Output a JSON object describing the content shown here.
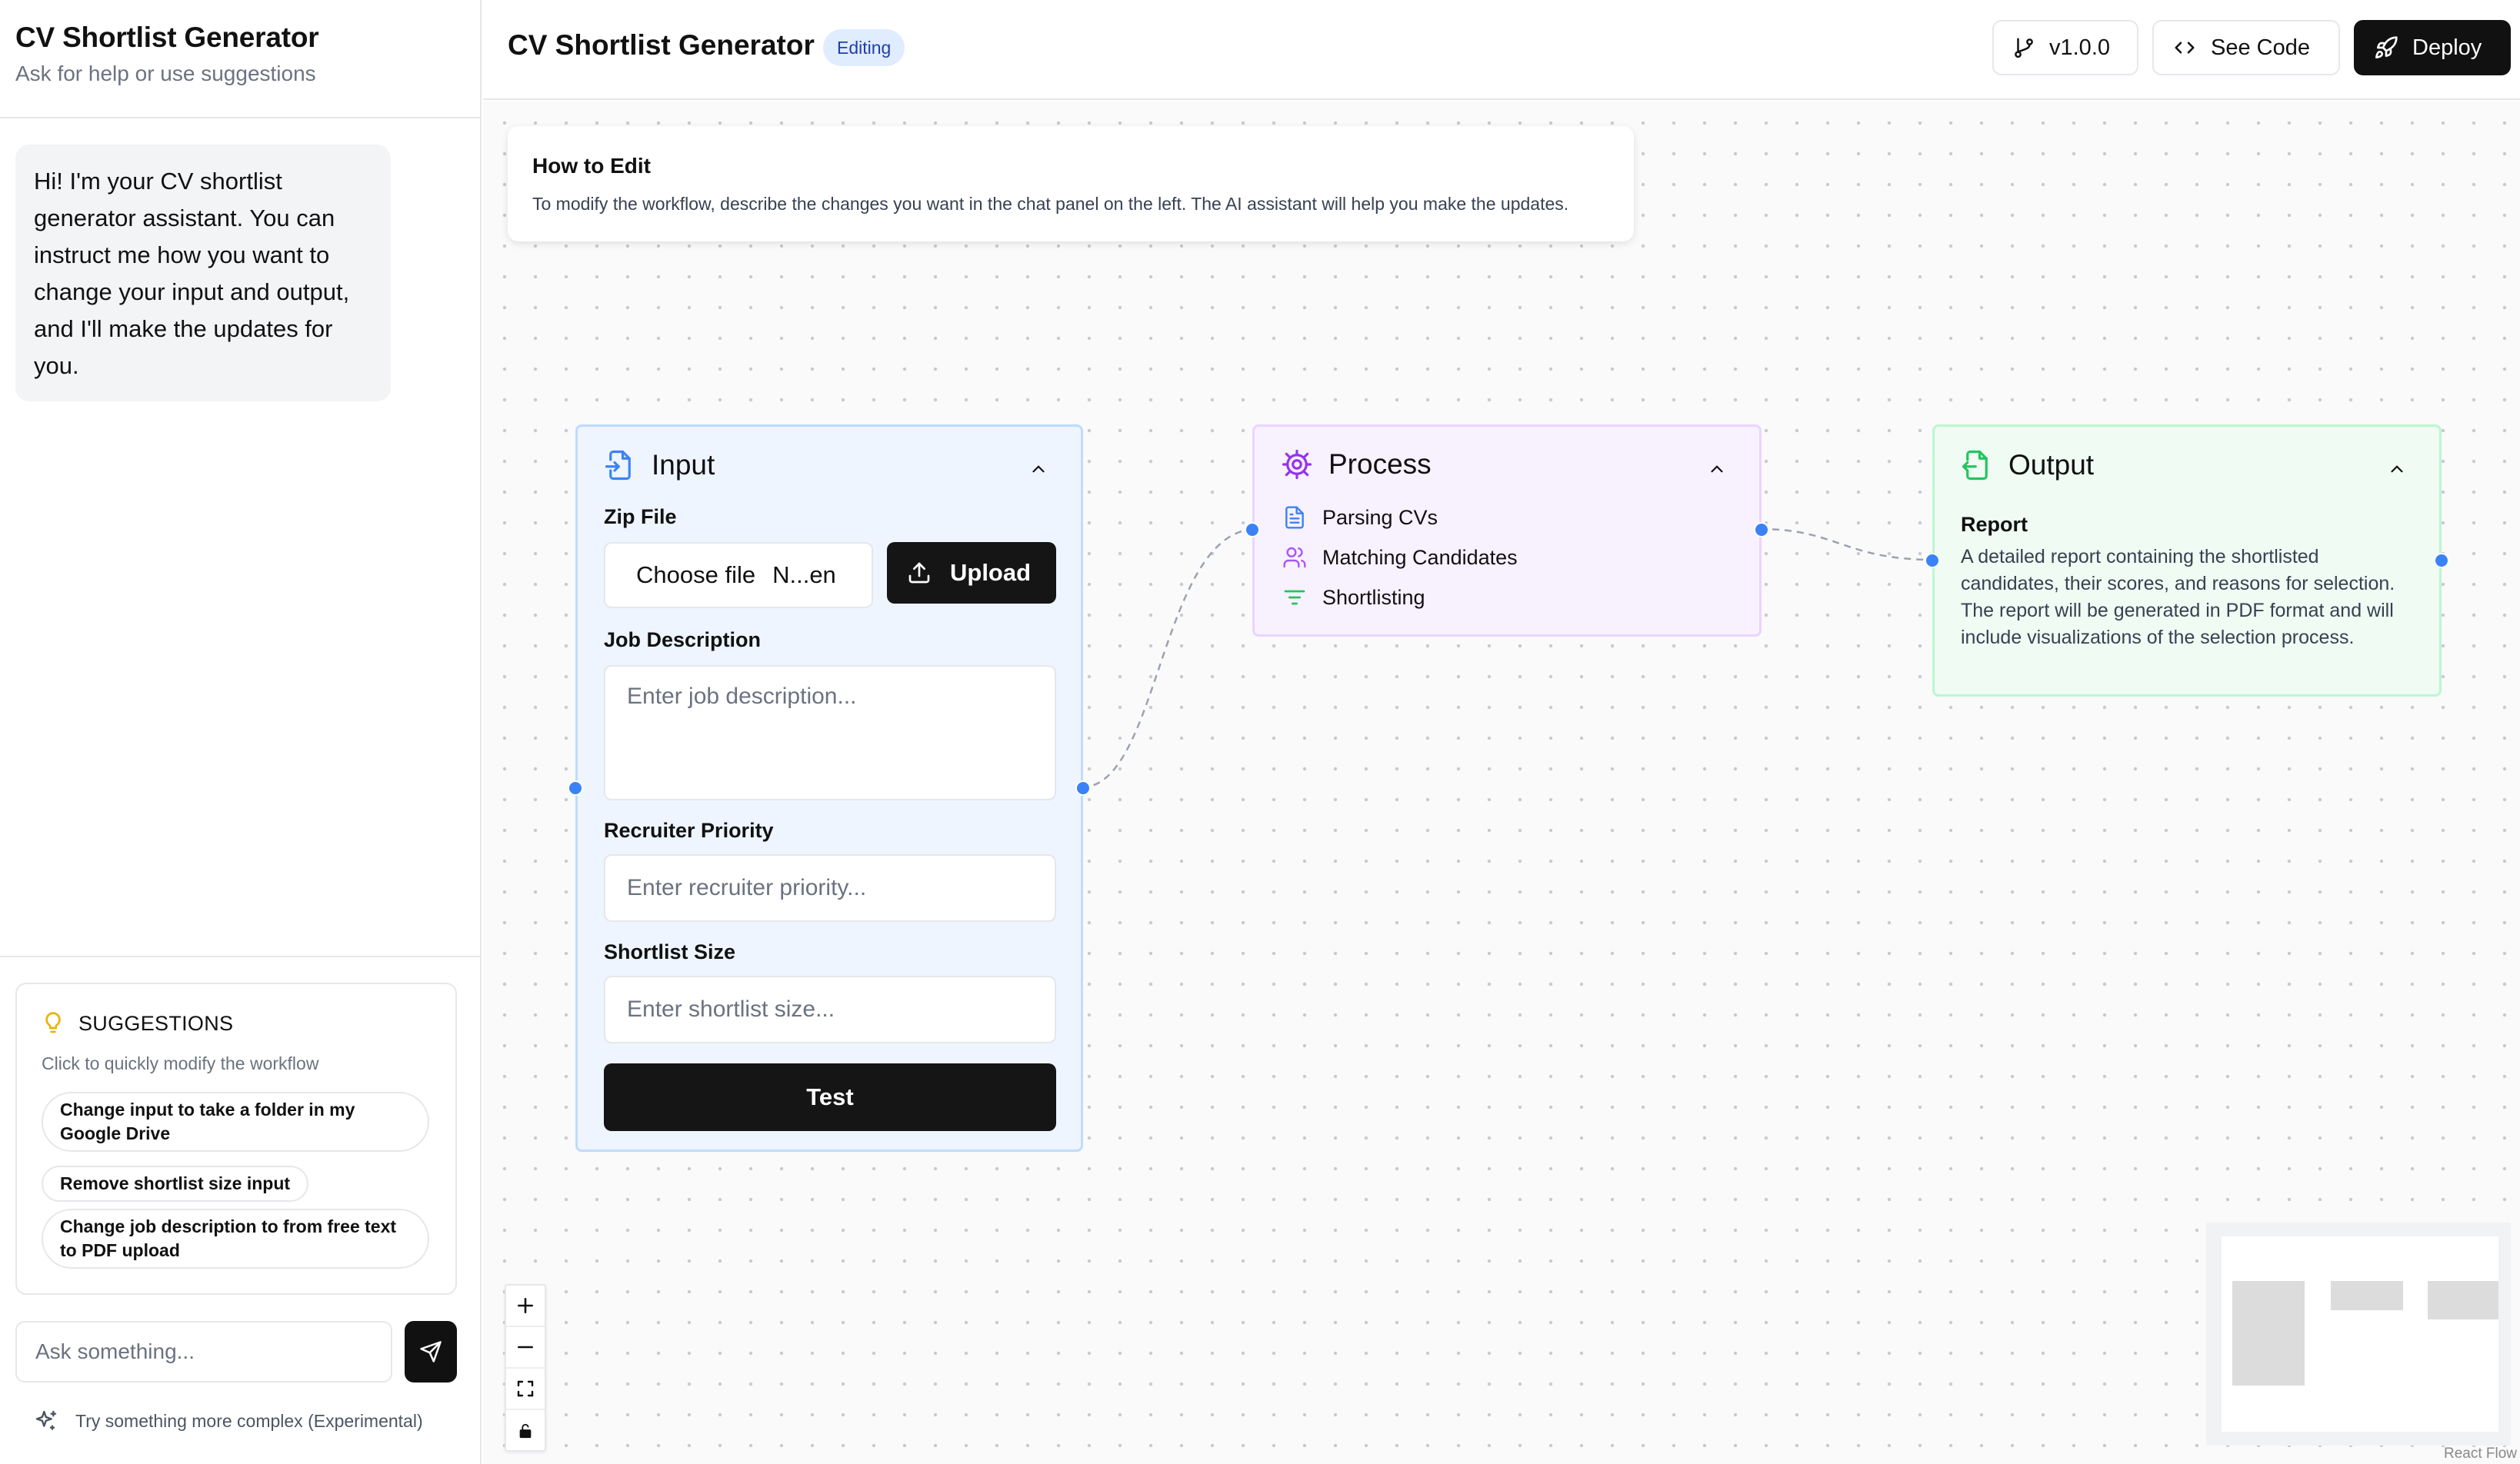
{
  "sidebar": {
    "title": "CV Shortlist Generator",
    "subtitle": "Ask for help or use suggestions",
    "assistant_message": "Hi! I'm your CV shortlist generator assistant. You can instruct me how you want to change your input and output, and I'll make the updates for you.",
    "suggestions": {
      "heading": "SUGGESTIONS",
      "subheading": "Click to quickly modify the workflow",
      "items": [
        "Change input to take a folder in my Google Drive",
        "Remove shortlist size input",
        "Change job description to from free text to PDF upload"
      ]
    },
    "ask_placeholder": "Ask something...",
    "complex_link": "Try something more complex (Experimental)"
  },
  "header": {
    "title": "CV Shortlist Generator",
    "badge": "Editing",
    "version_label": "v1.0.0",
    "see_code_label": "See Code",
    "deploy_label": "Deploy"
  },
  "howto": {
    "title": "How to Edit",
    "text": "To modify the workflow, describe the changes you want in the chat panel on the left. The AI assistant will help you make the updates."
  },
  "nodes": {
    "input": {
      "title": "Input",
      "zip_label": "Zip File",
      "choose_file": "Choose file",
      "file_name": "N...en",
      "upload_label": "Upload",
      "job_desc_label": "Job Description",
      "job_desc_placeholder": "Enter job description...",
      "priority_label": "Recruiter Priority",
      "priority_placeholder": "Enter recruiter priority...",
      "size_label": "Shortlist Size",
      "size_placeholder": "Enter shortlist size...",
      "test_label": "Test"
    },
    "process": {
      "title": "Process",
      "steps": [
        "Parsing CVs",
        "Matching Candidates",
        "Shortlisting"
      ]
    },
    "output": {
      "title": "Output",
      "label": "Report",
      "description": "A detailed report containing the shortlisted candidates, their scores, and reasons for selection. The report will be generated in PDF format and will include visualizations of the selection process."
    }
  },
  "attribution": "React Flow",
  "colors": {
    "accent_blue": "#3b82f6",
    "input_bg": "#eef5ff",
    "process_bg": "#f8f1ff",
    "output_bg": "#effbf3",
    "dark_button": "#151515"
  }
}
